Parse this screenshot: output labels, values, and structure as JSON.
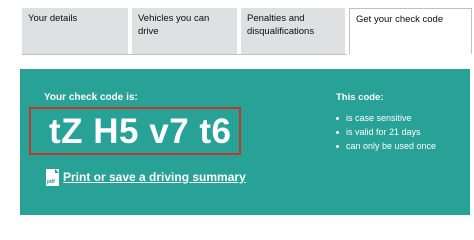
{
  "tabs": [
    {
      "label": "Your details"
    },
    {
      "label": "Vehicles you can drive"
    },
    {
      "label": "Penalties and disqualifications"
    },
    {
      "label": "Get your check code"
    }
  ],
  "check_code": {
    "label": "Your check code is:",
    "code": "tZ H5 v7 t6"
  },
  "summary_link": {
    "icon": "pdf-icon",
    "icon_text": "pdf",
    "label": "Print or save a driving summary"
  },
  "code_info": {
    "title": "This code:",
    "items": [
      "is case sensitive",
      "is valid for 21 days",
      "can only be used once"
    ]
  },
  "colors": {
    "panel": "#28a197",
    "highlight_border": "#c0392b",
    "tab_inactive": "#dee0e2"
  }
}
